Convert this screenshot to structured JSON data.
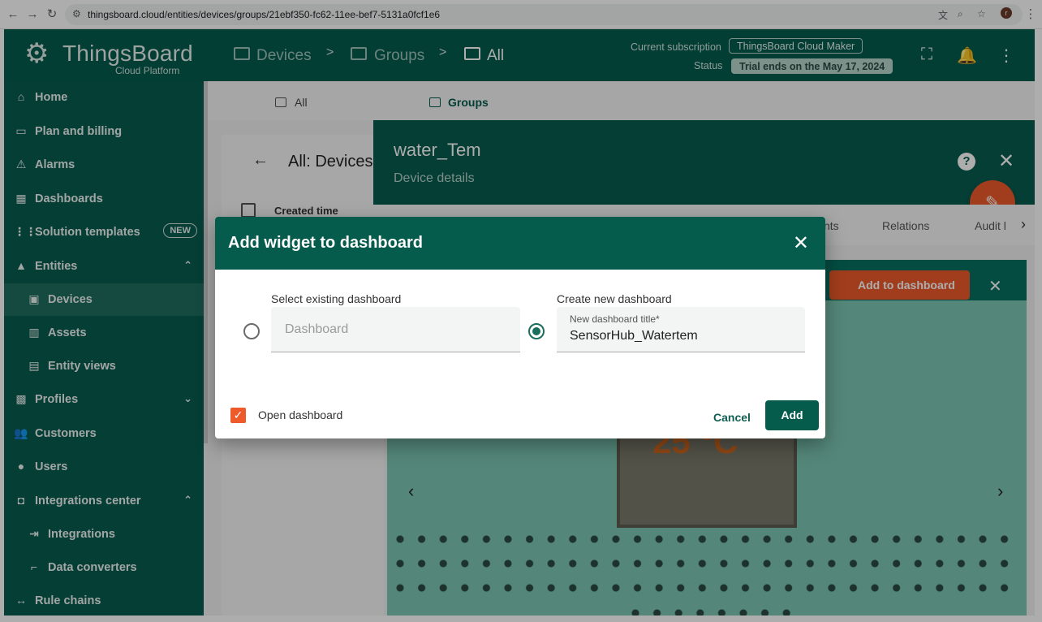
{
  "browser": {
    "url": "thingsboard.cloud/entities/devices/groups/21ebf350-fc62-11ee-bef7-5131a0fcf1e6",
    "profile_initial": "r"
  },
  "topbar": {
    "logo_main": "ThingsBoard",
    "logo_sub": "Cloud Platform",
    "breadcrumbs": [
      "Devices",
      "Groups",
      "All"
    ],
    "subscription_label": "Current subscription",
    "subscription_value": "ThingsBoard Cloud Maker",
    "status_label": "Status",
    "status_value": "Trial ends on the May 17, 2024"
  },
  "sidebar": {
    "items": [
      {
        "label": "Home",
        "icon": "home-icon"
      },
      {
        "label": "Plan and billing",
        "icon": "billing-icon"
      },
      {
        "label": "Alarms",
        "icon": "alarm-icon"
      },
      {
        "label": "Dashboards",
        "icon": "dashboards-icon"
      },
      {
        "label": "Solution templates",
        "icon": "templates-icon",
        "badge": "NEW"
      },
      {
        "label": "Entities",
        "icon": "entities-icon",
        "expanded": true
      },
      {
        "label": "Devices",
        "icon": "devices-icon",
        "sub": true,
        "active": true
      },
      {
        "label": "Assets",
        "icon": "assets-icon",
        "sub": true
      },
      {
        "label": "Entity views",
        "icon": "entity-views-icon",
        "sub": true
      },
      {
        "label": "Profiles",
        "icon": "profiles-icon",
        "expanded": false
      },
      {
        "label": "Customers",
        "icon": "customers-icon"
      },
      {
        "label": "Users",
        "icon": "users-icon"
      },
      {
        "label": "Integrations center",
        "icon": "integrations-center-icon",
        "expanded": true
      },
      {
        "label": "Integrations",
        "icon": "integrations-icon",
        "sub": true
      },
      {
        "label": "Data converters",
        "icon": "converters-icon",
        "sub": true
      },
      {
        "label": "Rule chains",
        "icon": "rule-chains-icon"
      }
    ]
  },
  "background": {
    "tabs": [
      "All",
      "Groups"
    ],
    "list_title": "All: Devices",
    "list_column": "Created time",
    "detail_title": "water_Tem",
    "detail_subtitle": "Device details",
    "detail_tabs": [
      "nts",
      "Relations",
      "Audit l"
    ],
    "add_to_dashboard": "Add to dashboard",
    "widget_preview_text": "25 °C"
  },
  "dialog": {
    "title": "Add widget to dashboard",
    "existing_label": "Select existing dashboard",
    "existing_placeholder": "Dashboard",
    "new_label": "Create new dashboard",
    "new_field_label": "New dashboard title*",
    "new_field_value": "SensorHub_Watertem",
    "selected_option": "new",
    "open_dashboard_label": "Open dashboard",
    "open_dashboard_checked": true,
    "cancel_label": "Cancel",
    "add_label": "Add"
  },
  "colors": {
    "primary": "#055c4d",
    "accent": "#ee5a2a",
    "widget_bg": "#7cc7b3"
  }
}
